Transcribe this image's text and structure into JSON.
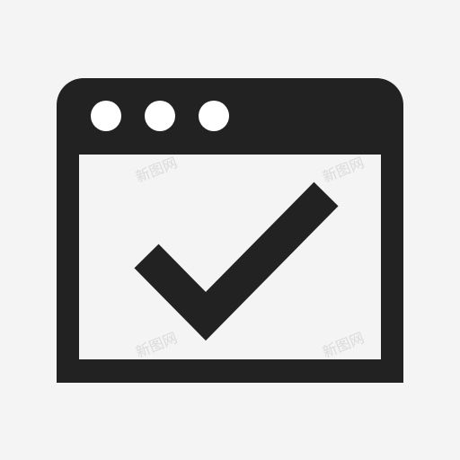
{
  "icon": {
    "name": "browser-window-check-icon",
    "frame_color": "#222222",
    "content_color": "#f4f4f4",
    "dot_color": "#ffffff",
    "check_color": "#222222",
    "dots": [
      "window-dot-1",
      "window-dot-2",
      "window-dot-3"
    ]
  },
  "background_color": "#f4f4f4",
  "watermark": {
    "text": "新图网",
    "color": "#d8d8d8"
  }
}
